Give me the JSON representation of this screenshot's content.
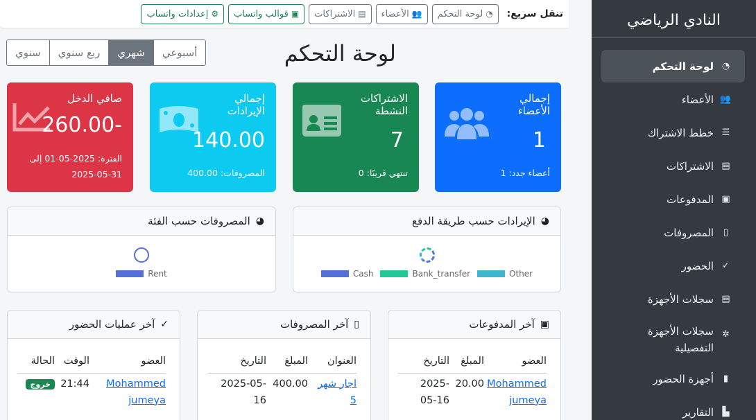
{
  "brand": "النادي الرياضي",
  "sidebar": {
    "items": [
      {
        "label": "لوحة التحكم",
        "icon": "dashboard-icon",
        "glyph": "◔"
      },
      {
        "label": "الأعضاء",
        "icon": "users-icon",
        "glyph": "👥"
      },
      {
        "label": "خطط الاشتراك",
        "icon": "list-icon",
        "glyph": "☰"
      },
      {
        "label": "الاشتراكات",
        "icon": "id-card-icon",
        "glyph": "▤"
      },
      {
        "label": "المدفوعات",
        "icon": "money-icon",
        "glyph": "▣"
      },
      {
        "label": "المصروفات",
        "icon": "receipt-icon",
        "glyph": "▯"
      },
      {
        "label": "الحضور",
        "icon": "clipboard-check-icon",
        "glyph": "✓"
      },
      {
        "label": "سجلات الأجهزة",
        "icon": "clipboard-list-icon",
        "glyph": "▤"
      },
      {
        "label": "سجلات الأجهزة التفصيلية",
        "icon": "microchip-icon",
        "glyph": "✲"
      },
      {
        "label": "أجهزة الحضور",
        "icon": "tablet-icon",
        "glyph": "▮"
      },
      {
        "label": "التقارير",
        "icon": "chart-icon",
        "glyph": "▙"
      }
    ]
  },
  "quick_nav": {
    "label": "تنقل سريع:",
    "buttons": [
      {
        "label": "لوحة التحكم",
        "icon": "dashboard-icon",
        "glyph": "◔"
      },
      {
        "label": "الأعضاء",
        "icon": "users-icon",
        "glyph": "👥"
      },
      {
        "label": "الاشتراكات",
        "icon": "id-card-icon",
        "glyph": "▤"
      },
      {
        "label": "قوالب واتساب",
        "icon": "whatsapp-template-icon",
        "glyph": "▣"
      },
      {
        "label": "إعدادات واتساب",
        "icon": "gears-icon",
        "glyph": "⚙"
      }
    ]
  },
  "page_title": "لوحة التحكم",
  "period_tabs": [
    {
      "label": "أسبوعي",
      "active": false
    },
    {
      "label": "شهري",
      "active": true
    },
    {
      "label": "ربع سنوي",
      "active": false
    },
    {
      "label": "سنوي",
      "active": false
    }
  ],
  "cards": {
    "members": {
      "title": "إجمالي الأعضاء",
      "value": "1",
      "footer": "أعضاء جدد: 1",
      "color": "#0d6efd"
    },
    "subscriptions": {
      "title": "الاشتراكات النشطة",
      "value": "7",
      "footer": "تنتهي قريبًا: 0",
      "color": "#198754"
    },
    "revenue": {
      "title": "إجمالي الإيرادات",
      "value": "140.00",
      "footer": "المصروفات: 400.00",
      "color": "#0dcaf0"
    },
    "net": {
      "title": "صافي الدخل",
      "value": "-260.00",
      "footer_line1": "الفترة: 2025-05-01 إلى",
      "footer_line2": "2025-05-31",
      "color": "#dc3545"
    }
  },
  "revenue_panel": {
    "title": "الإيرادات حسب طريقة الدفع",
    "icon": "pie-chart-icon",
    "legend": [
      {
        "label": "Cash",
        "color": "#5470d8"
      },
      {
        "label": "Bank_transfer",
        "color": "#20c997"
      },
      {
        "label": "Other",
        "color": "#3fb6cf"
      }
    ]
  },
  "expense_panel": {
    "title": "المصروفات حسب الفئة",
    "icon": "pie-chart-icon",
    "legend": [
      {
        "label": "Rent",
        "color": "#5470d8"
      }
    ]
  },
  "payments_panel": {
    "title": "آخر المدفوعات",
    "headers": [
      "العضو",
      "المبلغ",
      "التاريخ"
    ],
    "rows": [
      {
        "member_line1": "Mohammed",
        "member_line2": "jumeya",
        "amount": "20.00",
        "date_line1": "-2025",
        "date_line2": "05-16"
      }
    ]
  },
  "expenses_panel": {
    "title": "آخر المصروفات",
    "headers": [
      "العنوان",
      "المبلغ",
      "التاريخ"
    ],
    "rows": [
      {
        "title_line1": "اجار شهر",
        "title_line2": "5",
        "amount": "400.00",
        "date_line1": "-2025-05",
        "date_line2": "16"
      }
    ]
  },
  "attendance_panel": {
    "title": "آخر عمليات الحضور",
    "headers": [
      "العضو",
      "الوقت",
      "الحالة"
    ],
    "rows": [
      {
        "member_line1": "Mohammed",
        "member_line2": "jumeya",
        "time": "21:44",
        "status": "خروج"
      }
    ]
  }
}
